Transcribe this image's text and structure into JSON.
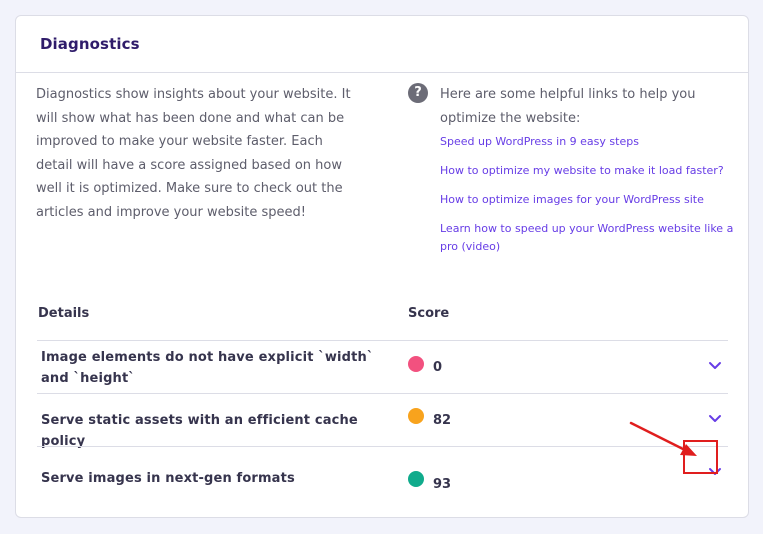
{
  "panel": {
    "title": "Diagnostics",
    "intro": "Diagnostics show insights about your website. It will show what has been done and what can be improved to make your website faster. Each detail will have a score assigned based on how well it is optimized. Make sure to check out the articles and improve your website speed!"
  },
  "help": {
    "icon": "question-circle-icon",
    "intro": "Here are some helpful links to help you optimize the website:",
    "links": [
      {
        "label": "Speed up WordPress in 9 easy steps"
      },
      {
        "label": "How to optimize my website to make it load faster?"
      },
      {
        "label": "How to optimize images for your WordPress site"
      },
      {
        "label": "Learn how to speed up your WordPress website like a pro (video)"
      }
    ]
  },
  "table": {
    "headers": {
      "details": "Details",
      "score": "Score"
    },
    "rows": [
      {
        "label": "Image elements do not have explicit `width` and `height`",
        "score": "0",
        "status_color": "#f2517f"
      },
      {
        "label": "Serve static assets with an efficient cache policy",
        "score": "82",
        "status_color": "#f8a31d"
      },
      {
        "label": "Serve images in next-gen formats",
        "score": "93",
        "status_color": "#10ab8c"
      }
    ]
  },
  "colors": {
    "accent": "#673de6",
    "annotation": "#e01e1e"
  }
}
